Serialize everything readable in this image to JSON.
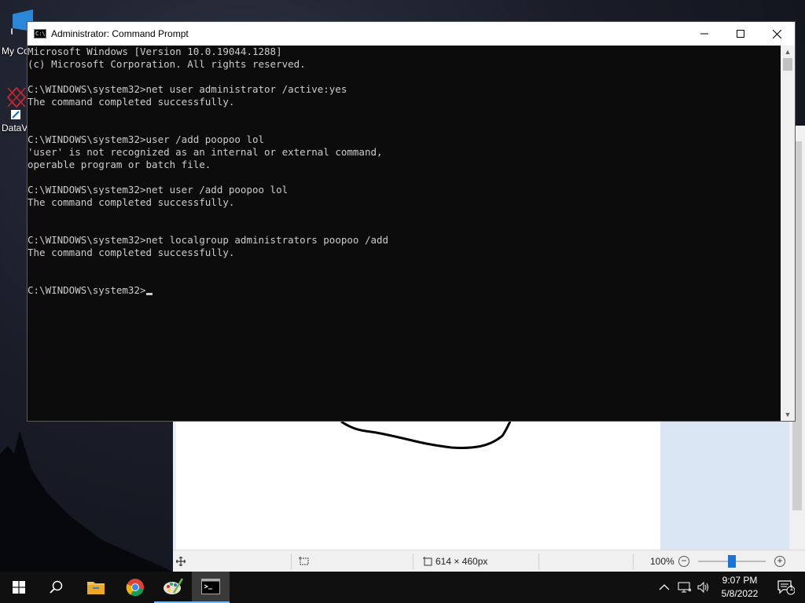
{
  "desktop": {
    "icons": [
      {
        "label": "My Co",
        "icon": "computer-icon"
      },
      {
        "label": "DataV",
        "icon": "datavault-icon"
      }
    ]
  },
  "paint": {
    "status": {
      "image_size": "614 × 460px",
      "zoom": "100%"
    }
  },
  "cmd": {
    "title": "Administrator: Command Prompt",
    "icon": "cmd-icon",
    "lines": [
      "Microsoft Windows [Version 10.0.19044.1288]",
      "(c) Microsoft Corporation. All rights reserved.",
      "",
      "C:\\WINDOWS\\system32>net user administrator /active:yes",
      "The command completed successfully.",
      "",
      "",
      "C:\\WINDOWS\\system32>user /add poopoo lol",
      "'user' is not recognized as an internal or external command,",
      "operable program or batch file.",
      "",
      "C:\\WINDOWS\\system32>net user /add poopoo lol",
      "The command completed successfully.",
      "",
      "",
      "C:\\WINDOWS\\system32>net localgroup administrators poopoo /add",
      "The command completed successfully.",
      "",
      "",
      "C:\\WINDOWS\\system32>"
    ]
  },
  "taskbar": {
    "apps": [
      {
        "name": "start",
        "icon": "windows-start-icon"
      },
      {
        "name": "search",
        "icon": "search-icon"
      },
      {
        "name": "file-explorer",
        "icon": "folder-icon"
      },
      {
        "name": "chrome",
        "icon": "chrome-icon"
      },
      {
        "name": "paint",
        "icon": "paint-icon"
      },
      {
        "name": "command-prompt",
        "icon": "cmd-icon"
      }
    ],
    "time": "9:07 PM",
    "date": "5/8/2022",
    "notifications": "1"
  }
}
